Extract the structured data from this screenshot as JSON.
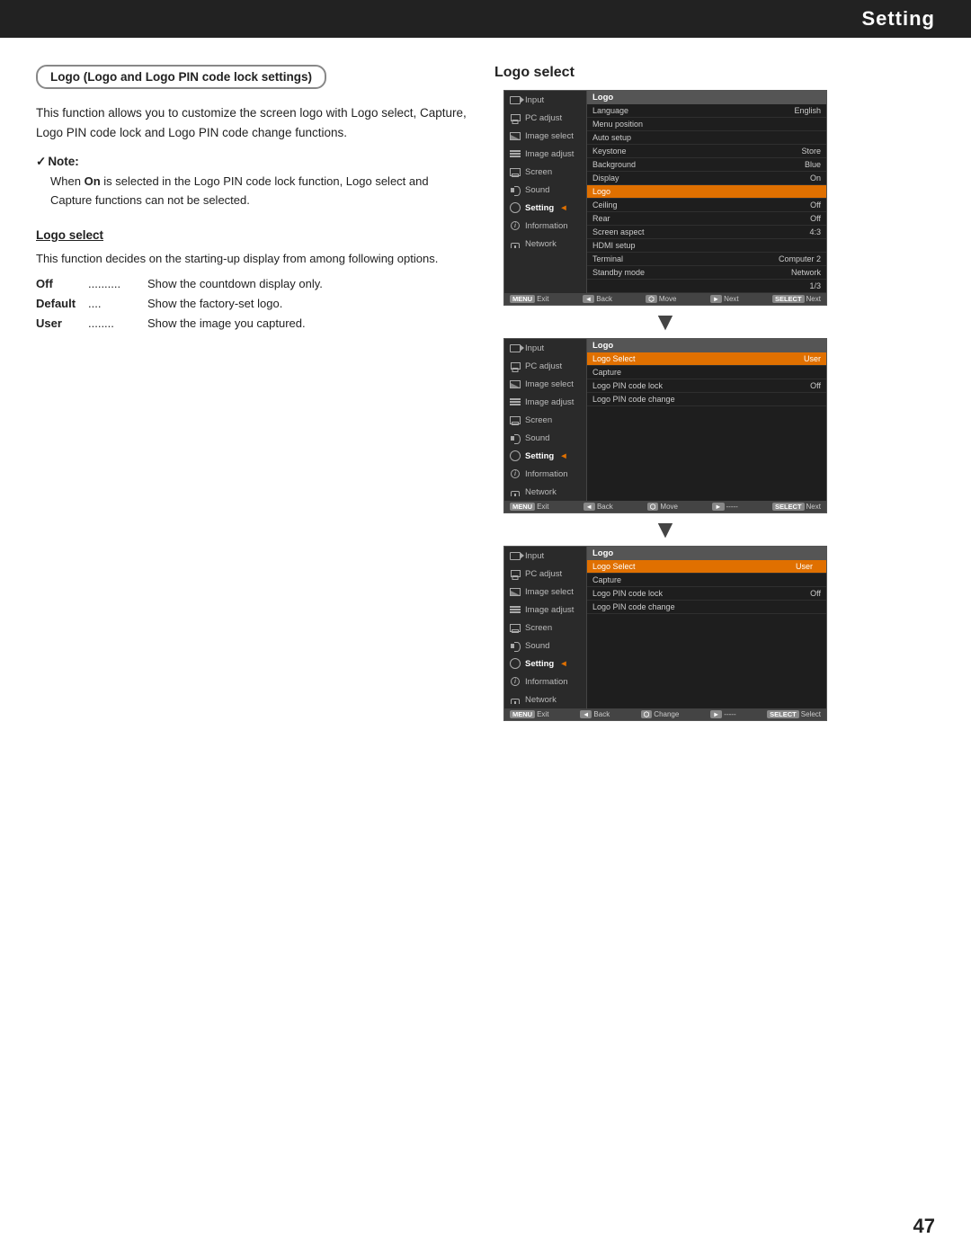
{
  "header": {
    "title": "Setting"
  },
  "page_number": "47",
  "section": {
    "heading": "Logo (Logo and Logo PIN code lock settings)",
    "body_text": "This function allows you to customize the screen logo with Logo select, Capture, Logo PIN code lock and Logo PIN code change functions.",
    "note_label": "Note:",
    "note_text": "When On is selected in the Logo PIN code lock function, Logo select and Capture functions can not be selected.",
    "subsection_title": "Logo select",
    "subsection_intro": "This function decides on the starting-up display from among following options.",
    "options": [
      {
        "key": "Off",
        "dots": "..........",
        "desc": "Show the countdown display only."
      },
      {
        "key": "Default",
        "dots": "....",
        "desc": "Show the factory-set logo."
      },
      {
        "key": "User",
        "dots": "........",
        "desc": "Show the image you captured."
      }
    ]
  },
  "right_panel": {
    "title": "Logo select",
    "screens": [
      {
        "id": "screen1",
        "sidebar_items": [
          {
            "label": "Input",
            "icon": "input",
            "active": false
          },
          {
            "label": "PC adjust",
            "icon": "pc",
            "active": false
          },
          {
            "label": "Image select",
            "icon": "image",
            "active": false
          },
          {
            "label": "Image adjust",
            "icon": "adjust",
            "active": false
          },
          {
            "label": "Screen",
            "icon": "screen",
            "active": false
          },
          {
            "label": "Sound",
            "icon": "sound",
            "active": false
          },
          {
            "label": "Setting",
            "icon": "setting",
            "active": true
          },
          {
            "label": "Information",
            "icon": "info",
            "active": false
          },
          {
            "label": "Network",
            "icon": "network",
            "active": false
          }
        ],
        "section_header": "Logo",
        "rows": [
          {
            "label": "Language",
            "value": "English",
            "highlighted": false,
            "subitem": false
          },
          {
            "label": "Menu position",
            "value": "",
            "highlighted": false,
            "subitem": false
          },
          {
            "label": "Auto setup",
            "value": "",
            "highlighted": false,
            "subitem": false
          },
          {
            "label": "Keystone",
            "value": "Store",
            "highlighted": false,
            "subitem": false
          },
          {
            "label": "Background",
            "value": "Blue",
            "highlighted": false,
            "subitem": false
          },
          {
            "label": "Display",
            "value": "On",
            "highlighted": false,
            "subitem": false
          },
          {
            "label": "Logo",
            "value": "",
            "highlighted": true,
            "subitem": false
          },
          {
            "label": "Ceiling",
            "value": "Off",
            "highlighted": false,
            "subitem": false
          },
          {
            "label": "Rear",
            "value": "Off",
            "highlighted": false,
            "subitem": false
          },
          {
            "label": "Screen aspect",
            "value": "4:3",
            "highlighted": false,
            "subitem": false
          },
          {
            "label": "HDMI setup",
            "value": "",
            "highlighted": false,
            "subitem": false
          },
          {
            "label": "Terminal",
            "value": "Computer 2",
            "highlighted": false,
            "subitem": false
          },
          {
            "label": "Standby mode",
            "value": "Network",
            "highlighted": false,
            "subitem": false
          },
          {
            "label": "1/3",
            "value": "",
            "highlighted": false,
            "subitem": false
          }
        ],
        "footer": [
          {
            "btn": "MENU",
            "action": "Exit"
          },
          {
            "btn": "◄",
            "action": "Back"
          },
          {
            "btn": "⬡",
            "action": "Move"
          },
          {
            "btn": "►",
            "action": "Next"
          },
          {
            "btn": "SELECT",
            "action": "Next"
          }
        ]
      },
      {
        "id": "screen2",
        "sidebar_items": [
          {
            "label": "Input",
            "icon": "input",
            "active": false
          },
          {
            "label": "PC adjust",
            "icon": "pc",
            "active": false
          },
          {
            "label": "Image select",
            "icon": "image",
            "active": false
          },
          {
            "label": "Image adjust",
            "icon": "adjust",
            "active": false
          },
          {
            "label": "Screen",
            "icon": "screen",
            "active": false
          },
          {
            "label": "Sound",
            "icon": "sound",
            "active": false
          },
          {
            "label": "Setting",
            "icon": "setting",
            "active": true
          },
          {
            "label": "Information",
            "icon": "info",
            "active": false
          },
          {
            "label": "Network",
            "icon": "network",
            "active": false
          }
        ],
        "section_header": "Logo",
        "rows": [
          {
            "label": "Logo Select",
            "value": "User",
            "highlighted": true
          },
          {
            "label": "Capture",
            "value": "",
            "highlighted": false
          },
          {
            "label": "Logo PIN code lock",
            "value": "Off",
            "highlighted": false
          },
          {
            "label": "Logo PIN code change",
            "value": "",
            "highlighted": false
          }
        ],
        "footer": [
          {
            "btn": "MENU",
            "action": "Exit"
          },
          {
            "btn": "◄",
            "action": "Back"
          },
          {
            "btn": "⬡",
            "action": "Move"
          },
          {
            "btn": "►",
            "action": "-----"
          },
          {
            "btn": "SELECT",
            "action": "Next"
          }
        ]
      },
      {
        "id": "screen3",
        "sidebar_items": [
          {
            "label": "Input",
            "icon": "input",
            "active": false
          },
          {
            "label": "PC adjust",
            "icon": "pc",
            "active": false
          },
          {
            "label": "Image select",
            "icon": "image",
            "active": false
          },
          {
            "label": "Image adjust",
            "icon": "adjust",
            "active": false
          },
          {
            "label": "Screen",
            "icon": "screen",
            "active": false
          },
          {
            "label": "Sound",
            "icon": "sound",
            "active": false
          },
          {
            "label": "Setting",
            "icon": "setting",
            "active": true
          },
          {
            "label": "Information",
            "icon": "info",
            "active": false
          },
          {
            "label": "Network",
            "icon": "network",
            "active": false
          }
        ],
        "section_header": "Logo",
        "rows": [
          {
            "label": "Logo Select",
            "value": "User ⬡",
            "highlighted": true,
            "spinner": true
          },
          {
            "label": "Capture",
            "value": "",
            "highlighted": false
          },
          {
            "label": "Logo PIN code lock",
            "value": "Off",
            "highlighted": false
          },
          {
            "label": "Logo PIN code change",
            "value": "",
            "highlighted": false
          }
        ],
        "footer": [
          {
            "btn": "MENU",
            "action": "Exit"
          },
          {
            "btn": "◄",
            "action": "Back"
          },
          {
            "btn": "⬡",
            "action": "Change"
          },
          {
            "btn": "►",
            "action": "-----"
          },
          {
            "btn": "SELECT",
            "action": "Select"
          }
        ]
      }
    ]
  }
}
